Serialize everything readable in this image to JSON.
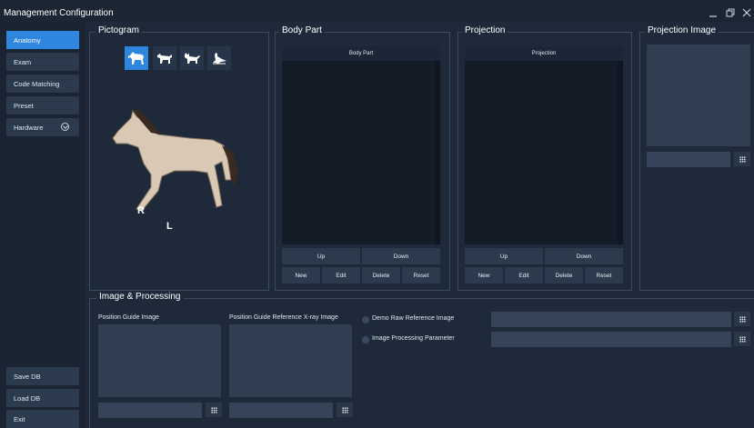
{
  "window": {
    "title": "Management Configuration",
    "minimize_icon": "minimize-icon",
    "restore_icon": "restore-icon",
    "close_icon": "close-icon"
  },
  "sidebar": {
    "items": [
      {
        "label": "Anatomy",
        "active": true
      },
      {
        "label": "Exam"
      },
      {
        "label": "Code Matching"
      },
      {
        "label": "Preset"
      },
      {
        "label": "Hardware",
        "icon": "chevron-down-circle-icon"
      }
    ],
    "bottom": [
      {
        "label": "Save DB"
      },
      {
        "label": "Load DB"
      },
      {
        "label": "Exit"
      }
    ]
  },
  "pictogram": {
    "title": "Pictogram",
    "animals": [
      {
        "icon": "horse-icon",
        "active": true
      },
      {
        "icon": "dog-icon"
      },
      {
        "icon": "cat-icon"
      },
      {
        "icon": "bird-icon"
      }
    ],
    "marker_right": "R",
    "marker_left": "L"
  },
  "body_part": {
    "title": "Body Part",
    "header": "Body Part",
    "buttons": {
      "up": "Up",
      "down": "Down",
      "new": "New",
      "edit": "Edit",
      "delete": "Delete",
      "reset": "Reset"
    }
  },
  "projection": {
    "title": "Projection",
    "header": "Projection",
    "buttons": {
      "up": "Up",
      "down": "Down",
      "new": "New",
      "edit": "Edit",
      "delete": "Delete",
      "reset": "Reset"
    }
  },
  "projection_image": {
    "title": "Projection Image",
    "field_value": "",
    "grid_icon": "grid-icon"
  },
  "image_processing": {
    "title": "Image & Processing",
    "position_guide_label": "Position Guide Image",
    "position_guide_ref_label": "Position Guide Reference X-ray Image",
    "demo_raw_label": "Demo Raw Reference Image",
    "processing_param_label": "Image Processing Parameter",
    "demo_raw_value": "",
    "processing_param_value": ""
  },
  "colors": {
    "background": "#1e2a3a",
    "accent": "#2e86de",
    "button": "#2c3a4d",
    "list_bg": "#141c28"
  }
}
